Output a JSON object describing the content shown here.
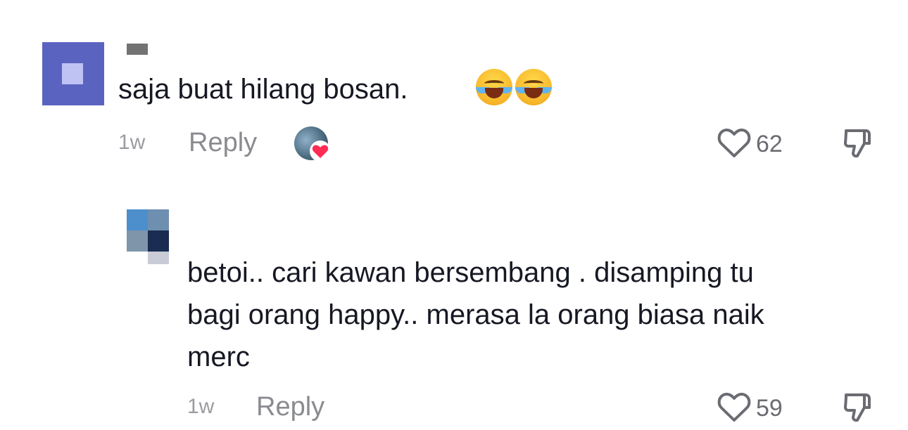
{
  "comments": [
    {
      "username": "",
      "text": "saja buat hilang bosan.",
      "emoji": [
        "face-with-tears-of-joy",
        "face-with-tears-of-joy"
      ],
      "time": "1w",
      "reply_label": "Reply",
      "like_count": "62",
      "liked_by_creator": true,
      "avatar_colors": [
        "#5b63c0",
        "#bfc3f3"
      ]
    }
  ],
  "replies": [
    {
      "username": "",
      "text_lines": [
        "betoi.. cari kawan bersembang . disamping tu",
        "bagi orang happy.. merasa la orang biasa naik",
        "merc"
      ],
      "time": "1w",
      "reply_label": "Reply",
      "like_count": "59"
    }
  ],
  "icons": {
    "like": "heart-outline-icon",
    "dislike": "thumbs-down-icon",
    "creator_like_badge": "red-heart-icon"
  },
  "colors": {
    "text": "#161823",
    "meta": "#9b9ca2",
    "heart_badge": "#fe2c55"
  }
}
